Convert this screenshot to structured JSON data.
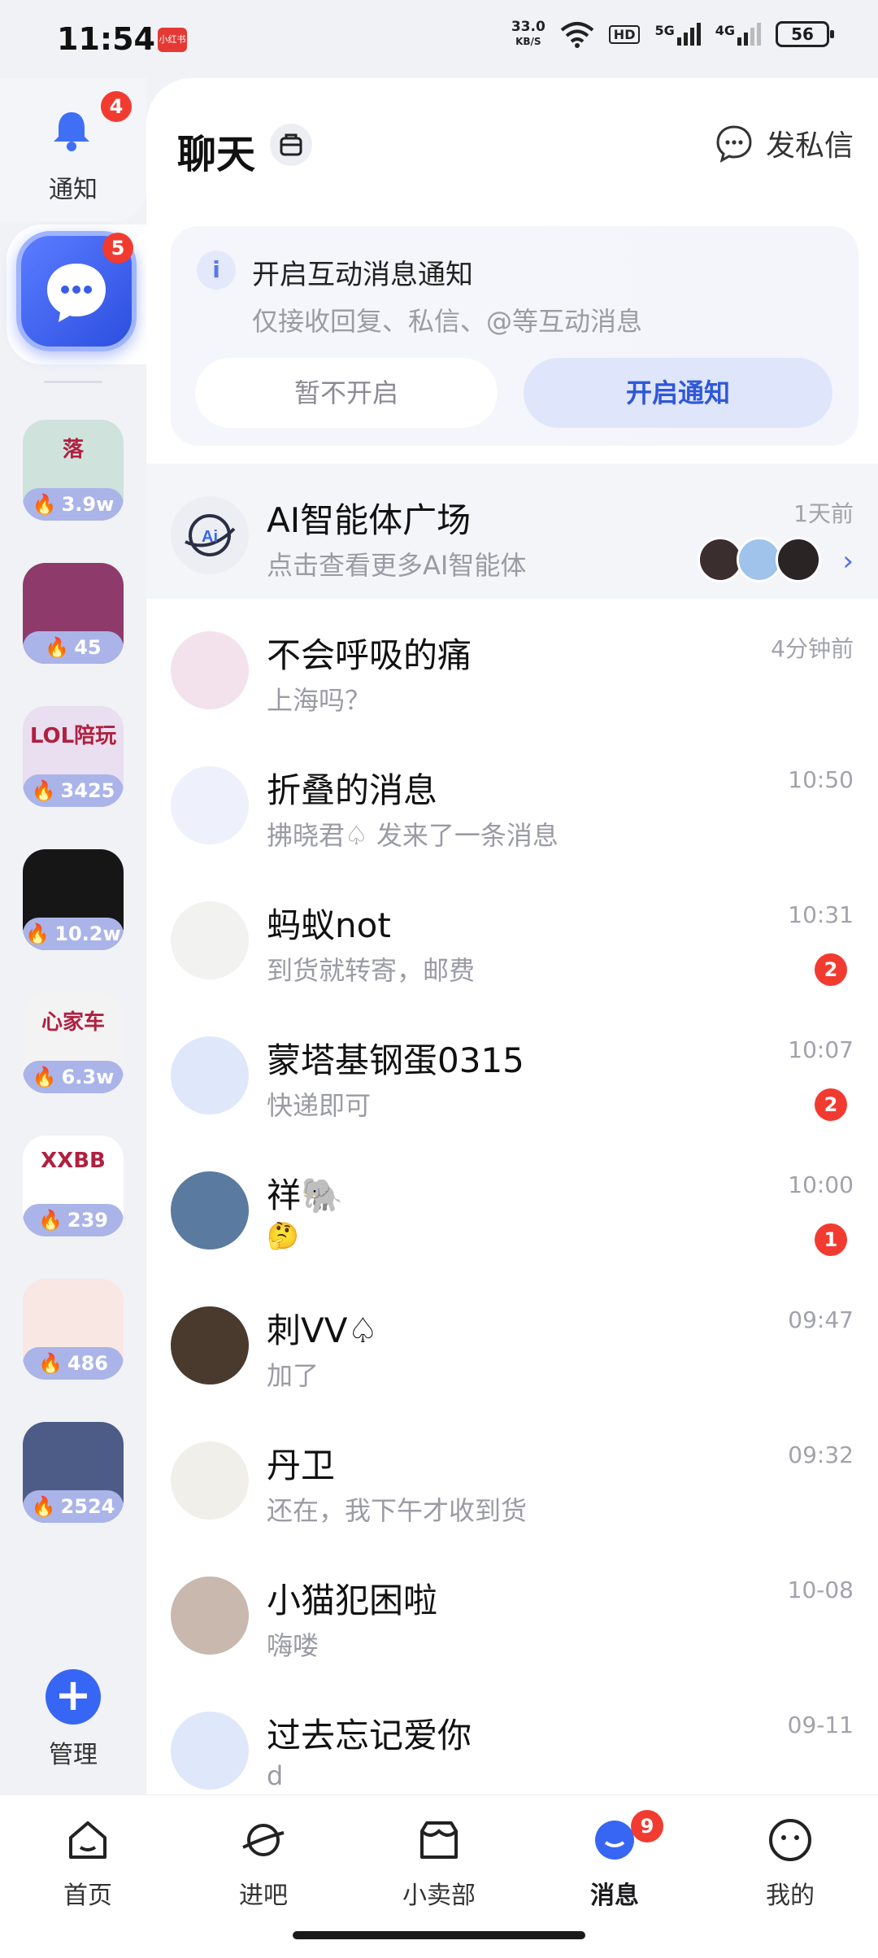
{
  "status_bar": {
    "time": "11:54",
    "app_badge": "小红书",
    "speed_value": "33.0",
    "speed_unit": "KB/S",
    "hd": "HD",
    "net1": "5G",
    "net2": "4G",
    "battery": "56"
  },
  "rail": {
    "notice_label": "通知",
    "notice_badge": "4",
    "chat_badge": "5",
    "forums": [
      {
        "name": "落",
        "count": "3.9w",
        "color": "#cfe3dc"
      },
      {
        "name": "",
        "count": "45",
        "color": "#8e3b6c"
      },
      {
        "name": "LOL陪玩",
        "count": "3425",
        "color": "#e9dff0"
      },
      {
        "name": "",
        "count": "10.2w",
        "color": "#161616"
      },
      {
        "name": "心家车",
        "count": "6.3w",
        "color": "#f3f3f3"
      },
      {
        "name": "XXBB",
        "count": "239",
        "color": "#ffffff"
      },
      {
        "name": "",
        "count": "486",
        "color": "#f9e7e3"
      },
      {
        "name": "",
        "count": "2524",
        "color": "#4c5c86"
      }
    ],
    "manage_label": "管理"
  },
  "header": {
    "title": "聊天",
    "dm_label": "发私信"
  },
  "notify_card": {
    "title": "开启互动消息通知",
    "subtitle": "仅接收回复、私信、@等互动消息",
    "decline": "暂不开启",
    "accept": "开启通知"
  },
  "ai_row": {
    "title": "AI智能体广场",
    "subtitle": "点击查看更多AI智能体",
    "time": "1天前"
  },
  "chats": [
    {
      "name": "不会呼吸的痛",
      "preview": "上海吗？",
      "time": "4分钟前",
      "badge": "",
      "avatar": "#f3e2ec"
    },
    {
      "name": "折叠的消息",
      "preview": "拂晓君♤ 发来了一条消息",
      "time": "10:50",
      "badge": "",
      "avatar": "#eef1fb"
    },
    {
      "name": "蚂蚁not",
      "preview": "到货就转寄，邮费",
      "time": "10:31",
      "badge": "2",
      "avatar": "#f2f2f0"
    },
    {
      "name": "蒙塔基钢蛋0315",
      "preview": "快递即可",
      "time": "10:07",
      "badge": "2",
      "avatar": "#dfe7fb"
    },
    {
      "name": "祥🐘",
      "preview": "🤔",
      "time": "10:00",
      "badge": "1",
      "avatar": "#5a7aa0"
    },
    {
      "name": "刺VV♤",
      "preview": "加了",
      "time": "09:47",
      "badge": "",
      "avatar": "#4a3a2e"
    },
    {
      "name": "丹卫",
      "preview": "还在，我下午才收到货",
      "time": "09:32",
      "badge": "",
      "avatar": "#f0efe9"
    },
    {
      "name": "小猫犯困啦",
      "preview": "嗨喽",
      "time": "10-08",
      "badge": "",
      "avatar": "#c9b8ad"
    },
    {
      "name": "过去忘记爱你",
      "preview": "d",
      "time": "09-11",
      "badge": "",
      "avatar": "#dfe7fb"
    }
  ],
  "nav": {
    "items": [
      "首页",
      "进吧",
      "小卖部",
      "消息",
      "我的"
    ],
    "message_badge": "9"
  },
  "colors": {
    "accent": "#3766f4",
    "badge": "#f23b30",
    "muted": "#9a9ba3"
  }
}
